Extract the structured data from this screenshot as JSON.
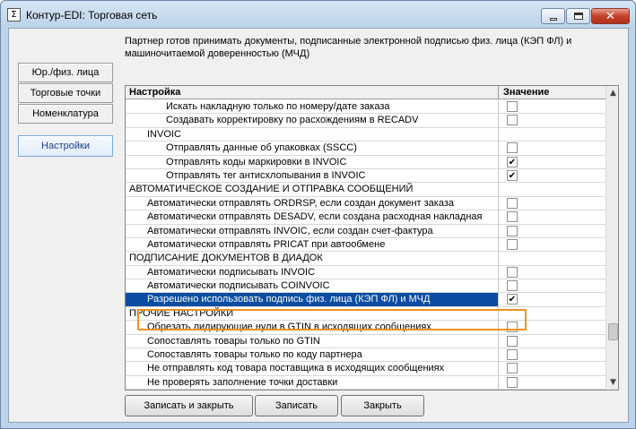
{
  "window": {
    "title": "Контур-EDI: Торговая сеть",
    "app_icon_glyph": "Σ",
    "close_glyph": "✕"
  },
  "info_text": "Партнер готов принимать документы, подписанные электронной подписью физ. лица (КЭП ФЛ) и машиночитаемой доверенностью (МЧД)",
  "sidebar": {
    "items": [
      {
        "label": "Юр./физ. лица"
      },
      {
        "label": "Торговые точки"
      },
      {
        "label": "Номенклатура"
      },
      {
        "label": "Настройки",
        "active": true
      }
    ]
  },
  "grid": {
    "columns": [
      "Настройка",
      "Значение"
    ],
    "rows": [
      {
        "label": "Искать накладную только по номеру/дате заказа",
        "level": 2,
        "checkbox": true,
        "checked": false
      },
      {
        "label": "Создавать корректировку по расхождениям в RECADV",
        "level": 2,
        "checkbox": true,
        "checked": false
      },
      {
        "label": "INVOIC",
        "level": 1,
        "checkbox": false
      },
      {
        "label": "Отправлять данные об упаковках (SSCC)",
        "level": 2,
        "checkbox": true,
        "checked": false
      },
      {
        "label": "Отправлять коды маркировки в INVOIC",
        "level": 2,
        "checkbox": true,
        "checked": true
      },
      {
        "label": "Отправлять тег антисхлопывания в INVOIC",
        "level": 2,
        "checkbox": true,
        "checked": true
      },
      {
        "label": "АВТОМАТИЧЕСКОЕ СОЗДАНИЕ И ОТПРАВКА СООБЩЕНИЙ",
        "level": 0,
        "checkbox": false
      },
      {
        "label": "Автоматически отправлять ORDRSP, если создан документ заказа",
        "level": 1,
        "checkbox": true,
        "checked": false
      },
      {
        "label": "Автоматически отправлять DESADV, если создана расходная накладная",
        "level": 1,
        "checkbox": true,
        "checked": false
      },
      {
        "label": "Автоматически отправлять INVOIC, если создан счет-фактура",
        "level": 1,
        "checkbox": true,
        "checked": false
      },
      {
        "label": "Автоматически отправлять PRICAT при автообмене",
        "level": 1,
        "checkbox": true,
        "checked": false
      },
      {
        "label": "ПОДПИСАНИЕ ДОКУМЕНТОВ В ДИАДОК",
        "level": 0,
        "checkbox": false
      },
      {
        "label": "Автоматически подписывать INVOIC",
        "level": 1,
        "checkbox": true,
        "checked": false
      },
      {
        "label": "Автоматически подписывать COINVOIC",
        "level": 1,
        "checkbox": true,
        "checked": false
      },
      {
        "label": "Разрешено использовать подпись физ. лица (КЭП ФЛ) и МЧД",
        "level": 1,
        "checkbox": true,
        "checked": true,
        "selected": true
      },
      {
        "label": "ПРОЧИЕ НАСТРОЙКИ",
        "level": 0,
        "checkbox": false
      },
      {
        "label": "Обрезать лидирующие нули в GTIN в исходящих сообщениях",
        "level": 1,
        "checkbox": true,
        "checked": false
      },
      {
        "label": "Сопоставлять товары только по GTIN",
        "level": 1,
        "checkbox": true,
        "checked": false
      },
      {
        "label": "Сопоставлять товары только по коду партнера",
        "level": 1,
        "checkbox": true,
        "checked": false
      },
      {
        "label": "Не отправлять код товара поставщика в исходящих сообщениях",
        "level": 1,
        "checkbox": true,
        "checked": false
      },
      {
        "label": "Не проверять заполнение точки доставки",
        "level": 1,
        "checkbox": true,
        "checked": false
      }
    ]
  },
  "scrollbar": {
    "up_glyph": "▲",
    "down_glyph": "▼"
  },
  "footer": {
    "save_close_label": "Записать и закрыть",
    "save_label": "Записать",
    "close_label": "Закрыть"
  },
  "colors": {
    "selection": "#0a4da1",
    "highlight_border": "#f0921c"
  }
}
